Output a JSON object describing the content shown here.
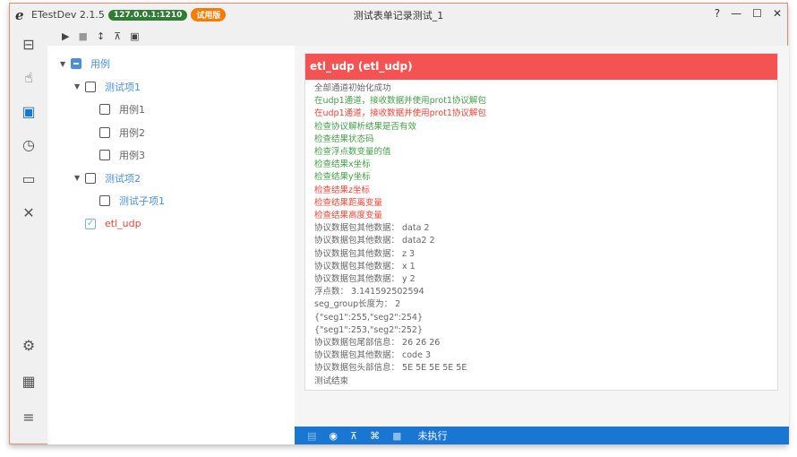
{
  "app": {
    "logo": "e",
    "name": "ETestDev 2.1.5",
    "address": "127.0.0.1:1210",
    "license": "试用版",
    "title": "测试表单记录测试_1"
  },
  "colors": {
    "address_bg": "#2e7d32",
    "license_bg": "#f57c00",
    "header": "#f55353",
    "status": "#1976d2",
    "green": "#43a047",
    "red": "#f44336",
    "gray": "#666666",
    "blue": "#4a90d9"
  },
  "window_buttons": [
    "?",
    "—",
    "☐",
    "✕"
  ],
  "sidebar": [
    "tree-icon",
    "touch-icon",
    "video-library-icon",
    "history-icon",
    "monitor-icon",
    "tools-icon",
    "settings-icon",
    "dashboard-icon",
    "menu-icon"
  ],
  "toolbar": [
    "play-icon",
    "stop-icon",
    "expand-icon",
    "clear-filter-icon",
    "save-icon"
  ],
  "tree": [
    {
      "label": "用例",
      "level": 0,
      "state": "partial",
      "arrow": true,
      "color": "blue"
    },
    {
      "label": "测试项1",
      "level": 1,
      "state": "empty",
      "arrow": true,
      "color": "blue"
    },
    {
      "label": "用例1",
      "level": 2,
      "state": "empty",
      "arrow": false,
      "color": "gray"
    },
    {
      "label": "用例2",
      "level": 2,
      "state": "empty",
      "arrow": false,
      "color": "gray"
    },
    {
      "label": "用例3",
      "level": 2,
      "state": "empty",
      "arrow": false,
      "color": "gray"
    },
    {
      "label": "测试项2",
      "level": 1,
      "state": "empty",
      "arrow": true,
      "color": "blue"
    },
    {
      "label": "测试子项1",
      "level": 2,
      "state": "empty",
      "arrow": false,
      "color": "blue"
    },
    {
      "label": "etl_udp",
      "level": 1,
      "state": "checked",
      "arrow": false,
      "color": "red"
    }
  ],
  "panel": {
    "title": "etl_udp (etl_udp)",
    "log": [
      {
        "text": "全部通道初始化成功",
        "color": "gray"
      },
      {
        "text": "在udp1通道，接收数据并使用prot1协议解包",
        "color": "green"
      },
      {
        "text": "在udp1通道，接收数据并使用prot1协议解包",
        "color": "red"
      },
      {
        "text": "检查协议解析结果是否有效",
        "color": "green"
      },
      {
        "text": "检查结果状态码",
        "color": "green"
      },
      {
        "text": "检查浮点数变量的值",
        "color": "green"
      },
      {
        "text": "检查结果x坐标",
        "color": "green"
      },
      {
        "text": "检查结果y坐标",
        "color": "green"
      },
      {
        "text": "检查结果z坐标",
        "color": "red"
      },
      {
        "text": "检查结果距离变量",
        "color": "red"
      },
      {
        "text": "检查结果高度变量",
        "color": "red"
      },
      {
        "text": "协议数据包其他数据： data 2",
        "color": "gray"
      },
      {
        "text": "协议数据包其他数据： data2 2",
        "color": "gray"
      },
      {
        "text": "协议数据包其他数据： z 3",
        "color": "gray"
      },
      {
        "text": "协议数据包其他数据： x 1",
        "color": "gray"
      },
      {
        "text": "协议数据包其他数据： y 2",
        "color": "gray"
      },
      {
        "text": "浮点数：  3.141592502594",
        "color": "gray"
      },
      {
        "text": "seg_group长度为：  2",
        "color": "gray"
      },
      {
        "text": "{\"seg1\":255,\"seg2\":254}",
        "color": "gray"
      },
      {
        "text": "{\"seg1\":253,\"seg2\":252}",
        "color": "gray"
      },
      {
        "text": "协议数据包尾部信息：  26 26 26",
        "color": "gray"
      },
      {
        "text": "协议数据包其他数据： code 3",
        "color": "gray"
      },
      {
        "text": "协议数据包头部信息：  5E 5E 5E 5E 5E",
        "color": "gray"
      },
      {
        "text": "测试结束",
        "color": "gray"
      }
    ]
  },
  "statusbar": {
    "icons": [
      "document-icon",
      "eye-icon",
      "clear-filter-icon",
      "command-icon",
      "stop-icon"
    ],
    "text": "未执行"
  }
}
